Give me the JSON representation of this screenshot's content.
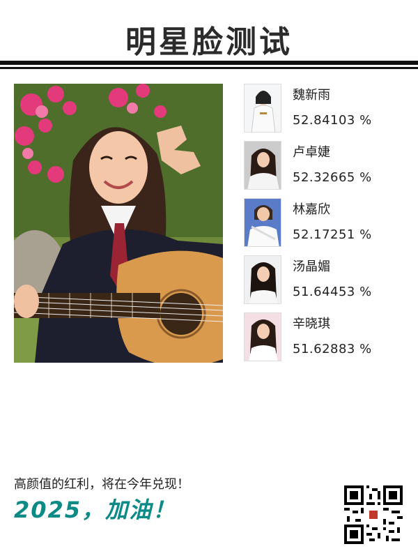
{
  "header": {
    "title": "明星脸测试"
  },
  "results": [
    {
      "name": "魏新雨",
      "score": "52.84103 %"
    },
    {
      "name": "卢卓婕",
      "score": "52.32665 %"
    },
    {
      "name": "林嘉欣",
      "score": "52.17251 %"
    },
    {
      "name": "汤晶媚",
      "score": "51.64453 %"
    },
    {
      "name": "辛晓琪",
      "score": "51.62883 %"
    }
  ],
  "footer": {
    "tagline": "高颜值的红利，将在今年兑现！",
    "slogan": "2025，加油！"
  },
  "colors": {
    "accent": "#0b8a86",
    "text": "#222222",
    "rule": "#111111"
  },
  "icons": {
    "qr": "qr-code-icon"
  }
}
